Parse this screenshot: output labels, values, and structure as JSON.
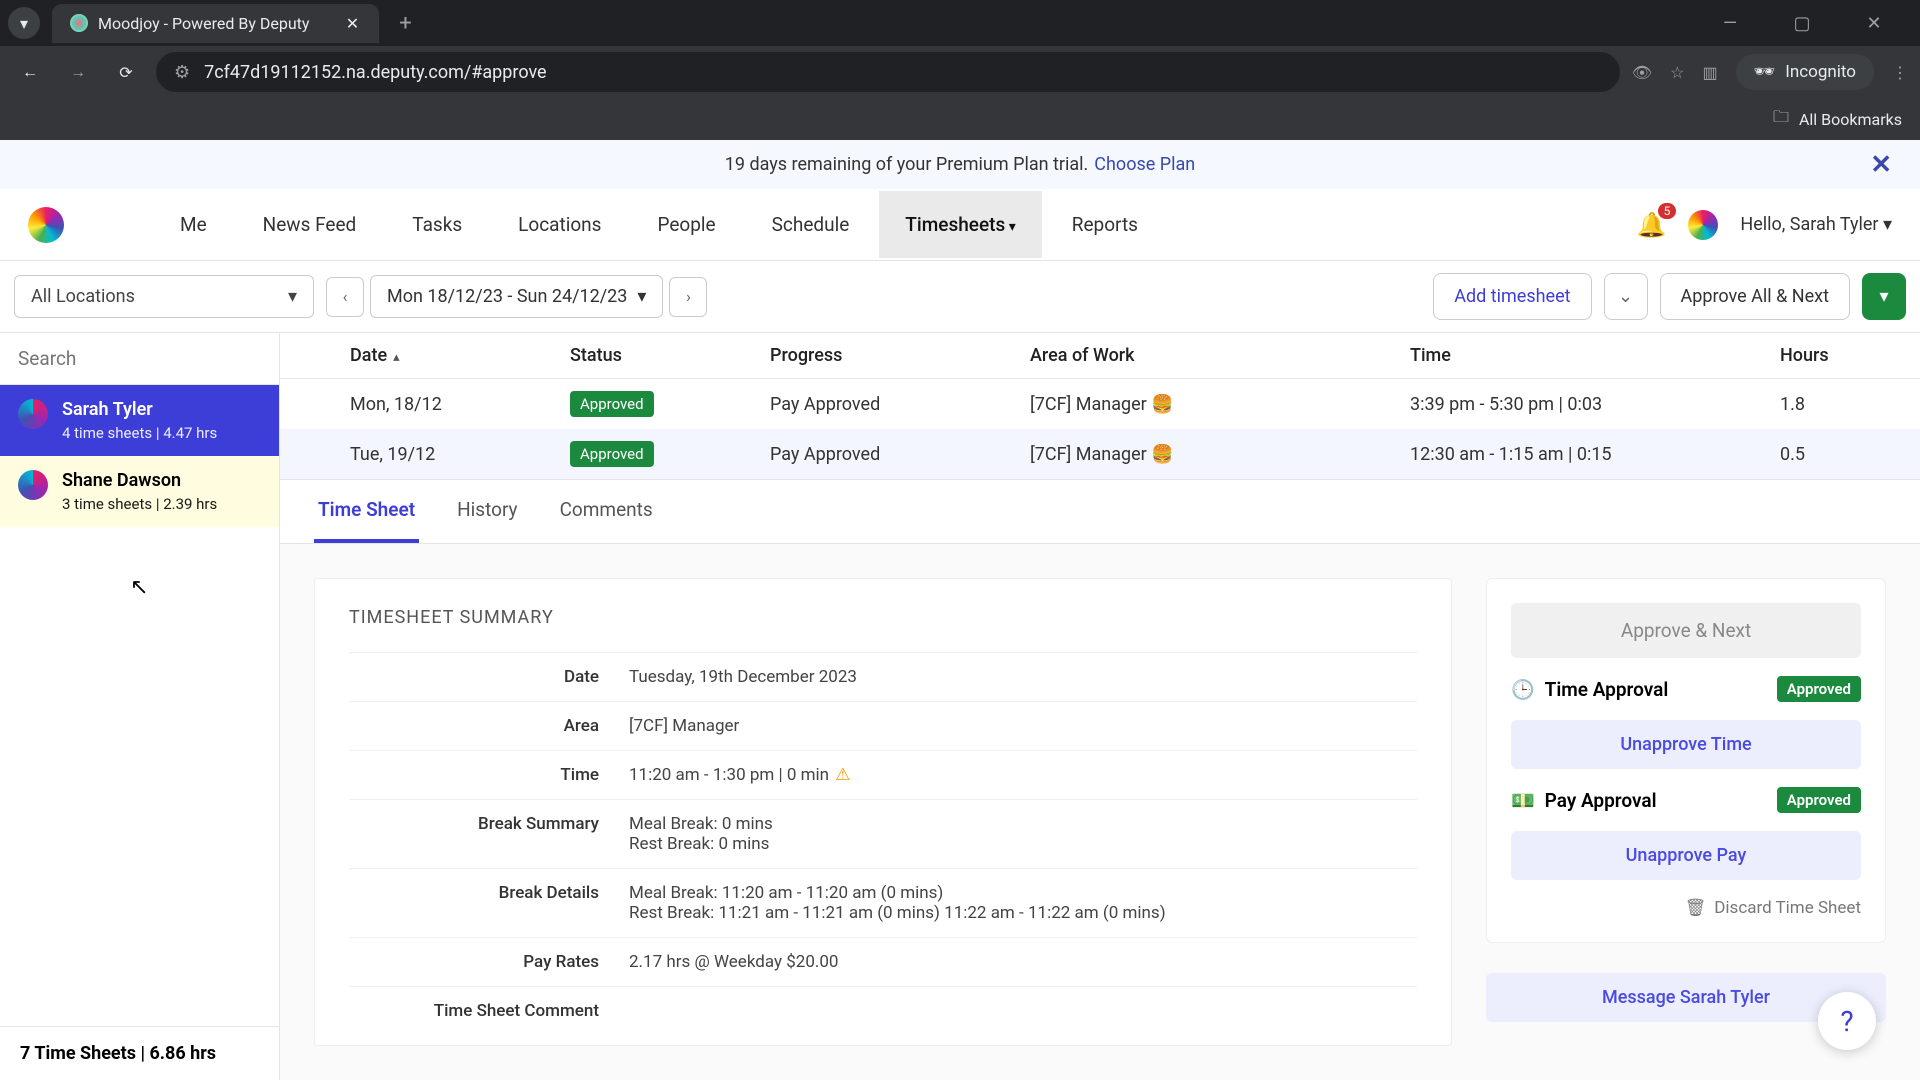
{
  "browser": {
    "tab_title": "Moodjoy - Powered By Deputy",
    "url": "7cf47d19112152.na.deputy.com/#approve",
    "incognito_label": "Incognito",
    "all_bookmarks": "All Bookmarks"
  },
  "trial": {
    "text": "19 days remaining of your Premium Plan trial.",
    "link": "Choose Plan"
  },
  "nav": {
    "items": [
      "Me",
      "News Feed",
      "Tasks",
      "Locations",
      "People",
      "Schedule",
      "Timesheets",
      "Reports"
    ],
    "active": "Timesheets",
    "notifications": "5",
    "greeting": "Hello, Sarah Tyler"
  },
  "filters": {
    "location": "All Locations",
    "date_range": "Mon 18/12/23 - Sun 24/12/23",
    "add_timesheet": "Add timesheet",
    "approve_all": "Approve All & Next"
  },
  "people": [
    {
      "name": "Sarah Tyler",
      "meta": "4 time sheets | 4.47 hrs",
      "selected": true
    },
    {
      "name": "Shane Dawson",
      "meta": "3 time sheets | 2.39 hrs",
      "hover": true
    }
  ],
  "sidebar_footer": "7 Time Sheets | 6.86 hrs",
  "search_placeholder": "Search",
  "table": {
    "headers": {
      "date": "Date",
      "status": "Status",
      "progress": "Progress",
      "area": "Area of Work",
      "time": "Time",
      "hours": "Hours"
    },
    "rows": [
      {
        "date": "Mon, 18/12",
        "status": "Approved",
        "progress": "Pay Approved",
        "area": "[7CF] Manager 🍔",
        "time": "3:39 pm - 5:30 pm | 0:03",
        "hours": "1.8"
      },
      {
        "date": "Tue, 19/12",
        "status": "Approved",
        "progress": "Pay Approved",
        "area": "[7CF] Manager 🍔",
        "time": "12:30 am - 1:15 am | 0:15",
        "hours": "0.5"
      }
    ]
  },
  "detail_tabs": {
    "items": [
      "Time Sheet",
      "History",
      "Comments"
    ],
    "active": "Time Sheet"
  },
  "summary": {
    "title": "TIMESHEET SUMMARY",
    "rows": {
      "date_label": "Date",
      "date_value": "Tuesday, 19th December 2023",
      "area_label": "Area",
      "area_value": "[7CF] Manager",
      "time_label": "Time",
      "time_value": "11:20 am - 1:30 pm | 0 min",
      "break_sum_label": "Break Summary",
      "break_sum_value_1": "Meal Break: 0 mins",
      "break_sum_value_2": "Rest Break: 0 mins",
      "break_det_label": "Break Details",
      "break_det_value_1": "Meal Break: 11:20 am - 11:20 am (0 mins)",
      "break_det_value_2": "Rest Break: 11:21 am - 11:21 am (0 mins) 11:22 am - 11:22 am (0 mins)",
      "pay_label": "Pay Rates",
      "pay_value": "2.17 hrs @ Weekday $20.00",
      "comment_label": "Time Sheet Comment"
    }
  },
  "actions": {
    "approve_next": "Approve & Next",
    "time_approval": "Time Approval",
    "pay_approval": "Pay Approval",
    "approved_badge": "Approved",
    "unapprove_time": "Unapprove Time",
    "unapprove_pay": "Unapprove Pay",
    "discard": "Discard Time Sheet",
    "message": "Message Sarah Tyler"
  }
}
